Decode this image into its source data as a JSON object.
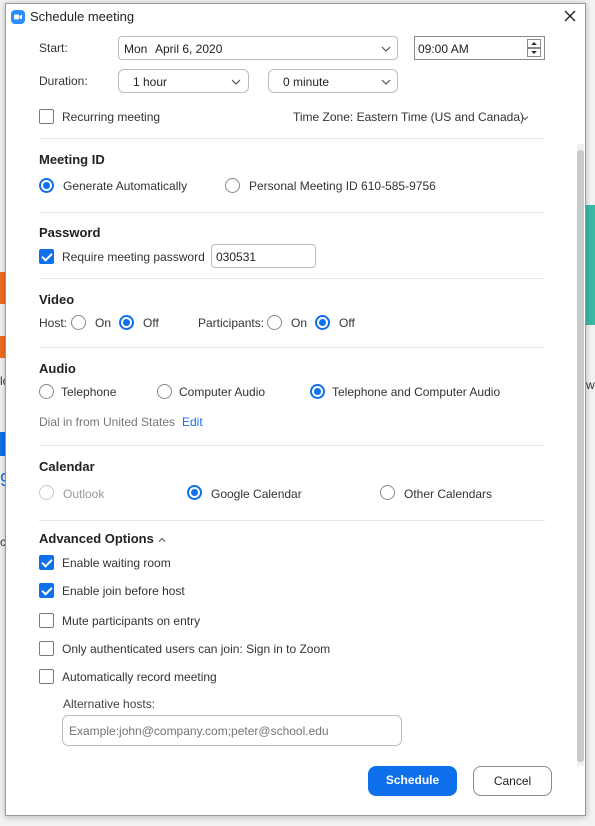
{
  "dialog": {
    "title": "Schedule meeting",
    "accent_color": "#0e71eb"
  },
  "schedule": {
    "start_label": "Start:",
    "start_day": "Mon",
    "start_date": "April 6, 2020",
    "start_time": "09:00 AM",
    "duration_label": "Duration:",
    "duration_hours": "1 hour",
    "duration_minutes": "0 minute",
    "recurring_label": "Recurring meeting",
    "recurring_checked": false,
    "timezone": "Time Zone: Eastern Time (US and Canada)"
  },
  "meeting_id": {
    "heading": "Meeting ID",
    "generate_label": "Generate Automatically",
    "personal_label": "Personal Meeting ID 610-585-9756",
    "selected": "generate"
  },
  "password": {
    "heading": "Password",
    "require_label": "Require meeting password",
    "require_checked": true,
    "value": "030531"
  },
  "video": {
    "heading": "Video",
    "host_label": "Host:",
    "participants_label": "Participants:",
    "on_label": "On",
    "off_label": "Off",
    "host": "off",
    "participants": "off"
  },
  "audio": {
    "heading": "Audio",
    "telephone_label": "Telephone",
    "computer_label": "Computer Audio",
    "both_label": "Telephone and Computer Audio",
    "selected": "both",
    "dial_in_text": "Dial in from United States",
    "edit_label": "Edit"
  },
  "calendar": {
    "heading": "Calendar",
    "outlook_label": "Outlook",
    "google_label": "Google Calendar",
    "other_label": "Other Calendars",
    "selected": "google"
  },
  "advanced": {
    "heading": "Advanced Options",
    "options": [
      {
        "label": "Enable waiting room",
        "checked": true
      },
      {
        "label": "Enable join before host",
        "checked": true
      },
      {
        "label": "Mute participants on entry",
        "checked": false
      },
      {
        "label": "Only authenticated users can join: Sign in to Zoom",
        "checked": false
      },
      {
        "label": "Automatically record meeting",
        "checked": false
      }
    ],
    "alt_hosts_label": "Alternative hosts:",
    "alt_hosts_placeholder": "Example:john@company.com;peter@school.edu"
  },
  "buttons": {
    "schedule": "Schedule",
    "cancel": "Cancel"
  },
  "background": {
    "partial_text_1": "lc",
    "partial_text_2": "9",
    "partial_text_3": "c",
    "partial_text_4": "w"
  }
}
